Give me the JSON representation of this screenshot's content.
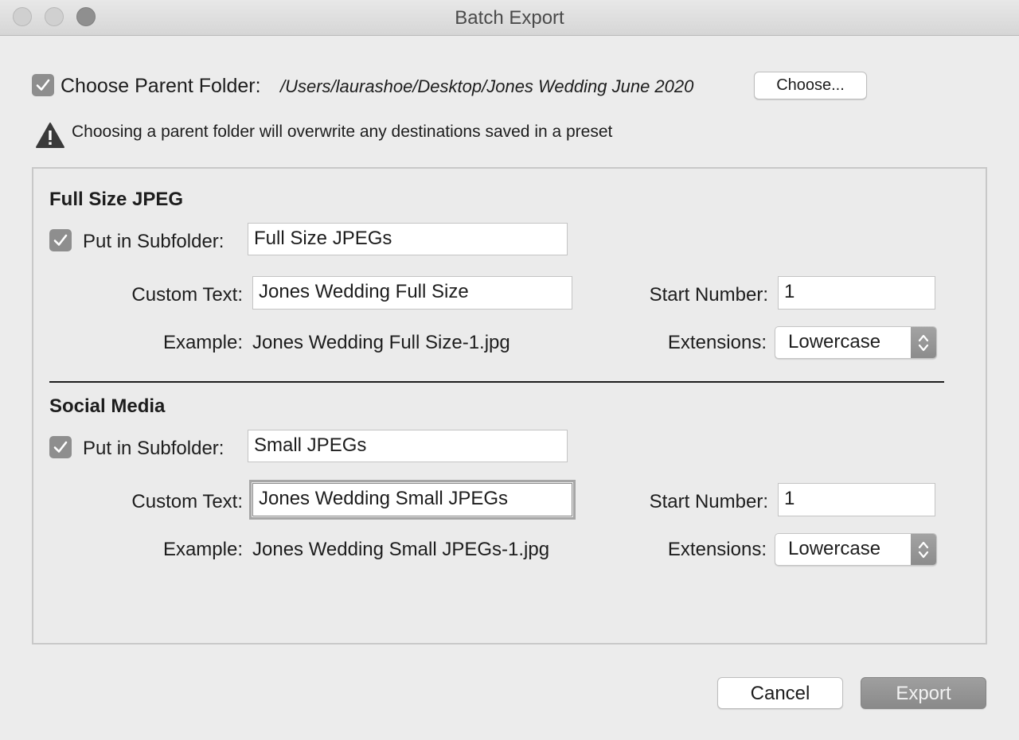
{
  "window": {
    "title": "Batch Export"
  },
  "parent_folder": {
    "checked": true,
    "label": "Choose Parent Folder:",
    "path": "/Users/laurashoe/Desktop/Jones Wedding June 2020",
    "choose_button": "Choose...",
    "warning": "Choosing a parent folder will overwrite any destinations saved in a preset"
  },
  "sections": [
    {
      "title": "Full Size JPEG",
      "subfolder_checked": true,
      "subfolder_label": "Put in Subfolder:",
      "subfolder_value": "Full Size JPEGs",
      "custom_text_label": "Custom Text:",
      "custom_text_value": "Jones Wedding Full Size",
      "start_number_label": "Start Number:",
      "start_number_value": "1",
      "example_label": "Example:",
      "example_value": "Jones Wedding Full Size-1.jpg",
      "extensions_label": "Extensions:",
      "extensions_value": "Lowercase"
    },
    {
      "title": "Social Media",
      "subfolder_checked": true,
      "subfolder_label": "Put in Subfolder:",
      "subfolder_value": "Small JPEGs",
      "custom_text_label": "Custom Text:",
      "custom_text_value": "Jones Wedding Small JPEGs",
      "start_number_label": "Start Number:",
      "start_number_value": "1",
      "example_label": "Example:",
      "example_value": "Jones Wedding Small JPEGs-1.jpg",
      "extensions_label": "Extensions:",
      "extensions_value": "Lowercase"
    }
  ],
  "footer": {
    "cancel_label": "Cancel",
    "export_label": "Export"
  },
  "colors": {
    "checkbox": "#8e8e8e",
    "export_button": "#9a9a9a",
    "background": "#ececec"
  }
}
